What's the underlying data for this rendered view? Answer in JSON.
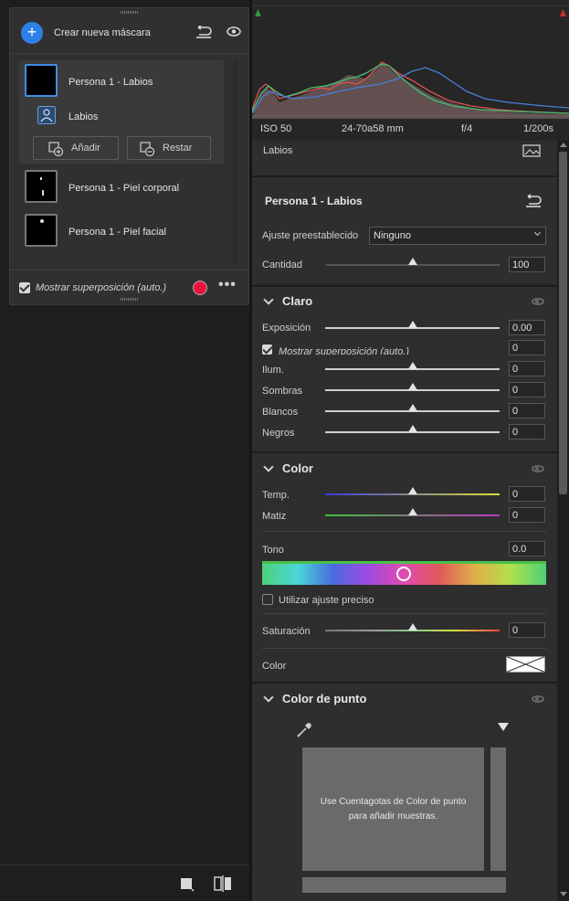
{
  "masks": {
    "create_label": "Crear nueva máscara",
    "items": [
      {
        "label": "Persona 1 - Labios"
      },
      {
        "label": "Labios"
      },
      {
        "label": "Persona 1 - Piel corporal"
      },
      {
        "label": "Persona 1 - Piel facial"
      }
    ],
    "add_label": "Añadir",
    "subtract_label": "Restar",
    "overlay_label": "Mostrar superposición (auto.)",
    "overlay_color": "#e8123c"
  },
  "histogram": {
    "iso": "ISO 50",
    "lens": "24-70a58 mm",
    "aperture": "f/4",
    "shutter": "1/200s"
  },
  "panel": {
    "cut_label": "Labios",
    "mask_title": "Persona 1 - Labios",
    "preset_label": "Ajuste preestablecido",
    "preset_value": "Ninguno",
    "amount_label": "Cantidad",
    "amount_value": "100",
    "light": {
      "title": "Claro",
      "exposure_label": "Exposición",
      "exposure_value": "0.00",
      "ghost_overlay": "Mostrar superposición (auto.)",
      "ghost_value": "0",
      "highlights_label": "Ilum.",
      "highlights_value": "0",
      "shadows_label": "Sombras",
      "shadows_value": "0",
      "whites_label": "Blancos",
      "whites_value": "0",
      "blacks_label": "Negros",
      "blacks_value": "0"
    },
    "color": {
      "title": "Color",
      "temp_label": "Temp.",
      "temp_value": "0",
      "tint_label": "Matiz",
      "tint_value": "0",
      "hue_label": "Tono",
      "hue_value": "0.0",
      "fine_label": "Utilizar ajuste preciso",
      "saturation_label": "Saturación",
      "saturation_value": "0",
      "color_label": "Color"
    },
    "point_color": {
      "title": "Color de punto",
      "hint": "Use Cuentagotas de Color de punto para añadir muestras."
    }
  }
}
